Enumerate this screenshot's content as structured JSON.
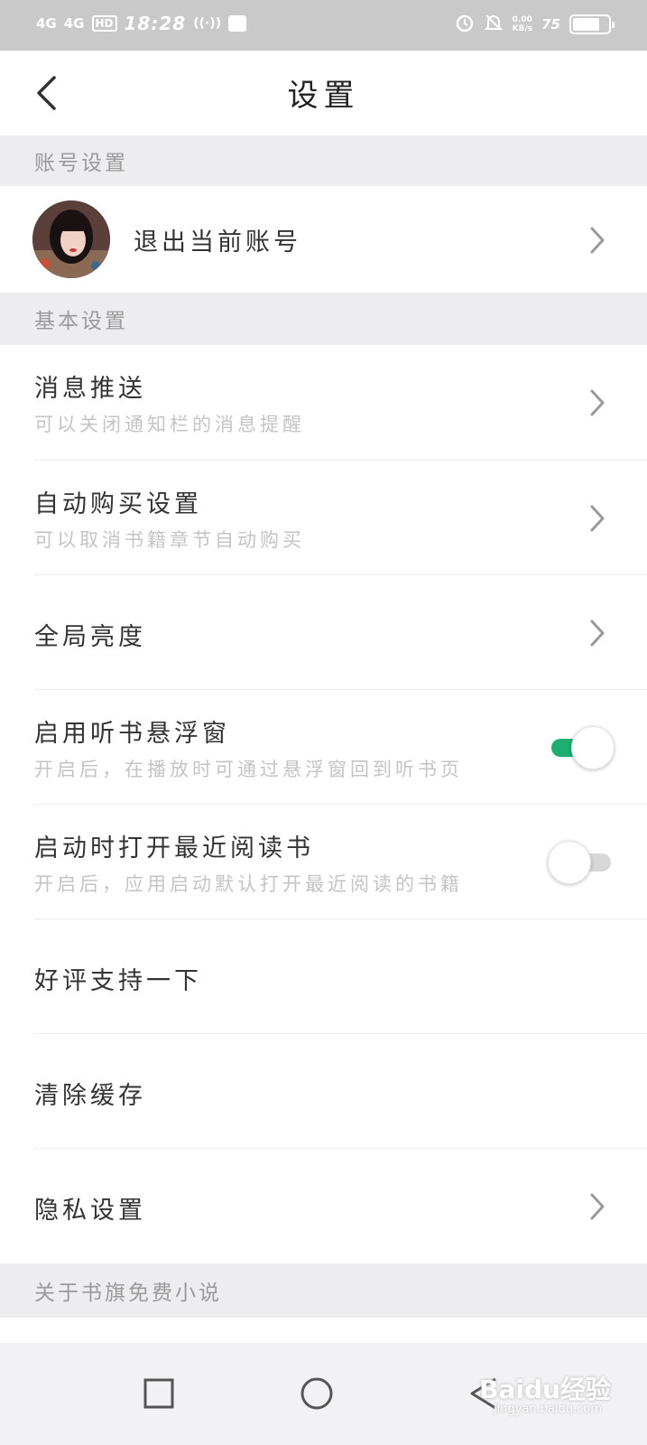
{
  "status_bar": {
    "network_1": "4G",
    "network_2": "4G",
    "hd": "HD",
    "time": "18:28",
    "speed_value": "0.00",
    "speed_unit": "KB/s",
    "battery_text": "75",
    "battery_level": 0.75
  },
  "nav": {
    "title": "设置"
  },
  "sections": {
    "account": "账号设置",
    "basic": "基本设置",
    "about": "关于书旗免费小说"
  },
  "account": {
    "logout_label": "退出当前账号"
  },
  "rows": {
    "push_title": "消息推送",
    "push_sub": "可以关闭通知栏的消息提醒",
    "auto_buy_title": "自动购买设置",
    "auto_buy_sub": "可以取消书籍章节自动购买",
    "brightness_title": "全局亮度",
    "float_title": "启用听书悬浮窗",
    "float_sub": "开启后，在播放时可通过悬浮窗回到听书页",
    "float_on": true,
    "recent_title": "启动时打开最近阅读书",
    "recent_sub": "开启后，应用启动默认打开最近阅读的书籍",
    "recent_on": false,
    "rate_title": "好评支持一下",
    "cache_title": "清除缓存",
    "privacy_title": "隐私设置"
  },
  "colors": {
    "accent_green": "#1fae72",
    "section_bg": "#ededf0",
    "status_bar_bg": "#c9c9c9"
  },
  "watermark": {
    "main": "Baidu经验",
    "sub": "jingyan.baidu.com"
  }
}
